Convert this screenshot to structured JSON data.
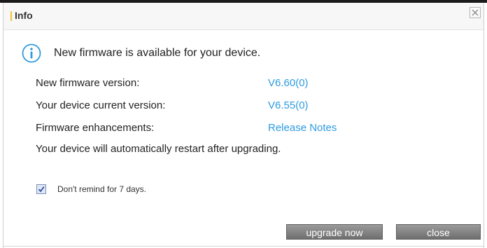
{
  "dialog": {
    "title": "Info",
    "close_icon": "close-icon"
  },
  "info": {
    "icon": "info-icon",
    "message": "New firmware is available for your device."
  },
  "fields": [
    {
      "label": "New firmware version:",
      "value": "V6.60(0)"
    },
    {
      "label": "Your device current version:",
      "value": "V6.55(0)"
    },
    {
      "label": "Firmware enhancements:",
      "value": "Release Notes"
    }
  ],
  "restart_notice": "Your device will automatically restart after upgrading.",
  "remind": {
    "checked": true,
    "label": "Don't remind for 7 days."
  },
  "buttons": {
    "upgrade_label": "upgrade now",
    "close_label": "close"
  },
  "colors": {
    "link": "#2e9be0",
    "button": "#7d7d7d",
    "accent": "#f2c230"
  }
}
